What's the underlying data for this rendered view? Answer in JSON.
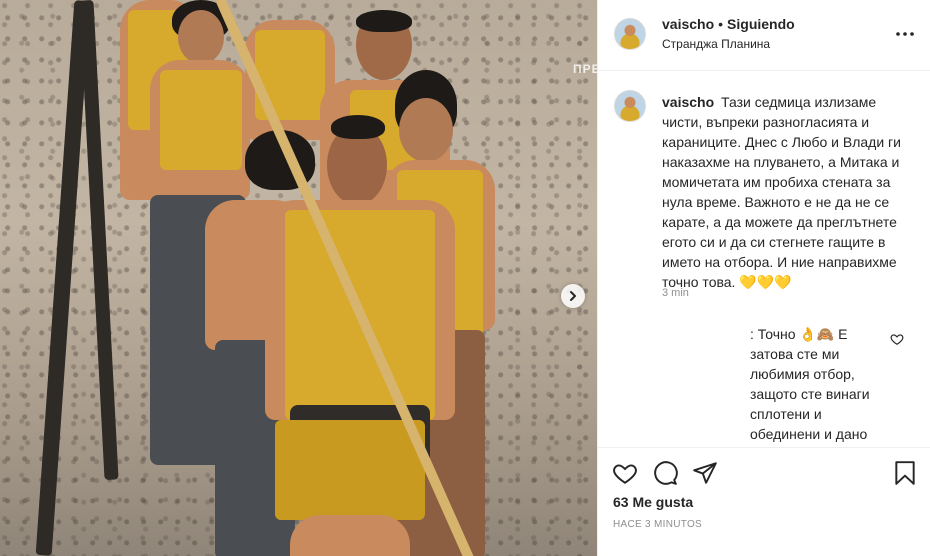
{
  "photo": {
    "watermark": "ПРЕ"
  },
  "post": {
    "username": "vaischo",
    "separator": "•",
    "follow_status": "Siguiendo",
    "location": "Странджа Планина"
  },
  "caption": {
    "username": "vaischo",
    "text": "Тази седмица излизаме чисти, въпреки разногласията и караниците. Днес с Любо и Влади ги наказахме на плуването, а Митака и момичетата им пробиха стената за нула време. Важното е не да не се карате, а да можете да преглътнете егото си и да си стегнете гащите в името на отбора. И ние направихме точно това. 💛💛💛",
    "age": "3 min"
  },
  "comment": {
    "text": ": Точно 👌🙈 Е затова сте ми любимия отбор, защото сте винаги сплотени и обединени и дано да няма пак такива премеждия между вас ама сигурно ще има не съм напълно сигурен😅"
  },
  "engagement": {
    "likes": "63 Me gusta",
    "timestamp": "HACE 3 MINUTOS"
  },
  "icons": {
    "like": "heart-icon",
    "comment": "comment-icon",
    "share": "share-icon",
    "save": "bookmark-icon",
    "more": "more-icon",
    "next": "chevron-right-icon"
  },
  "colors": {
    "text": "#262626",
    "secondary": "#8e8e8e",
    "border": "#efefef",
    "uniform": "#d7a92c"
  }
}
